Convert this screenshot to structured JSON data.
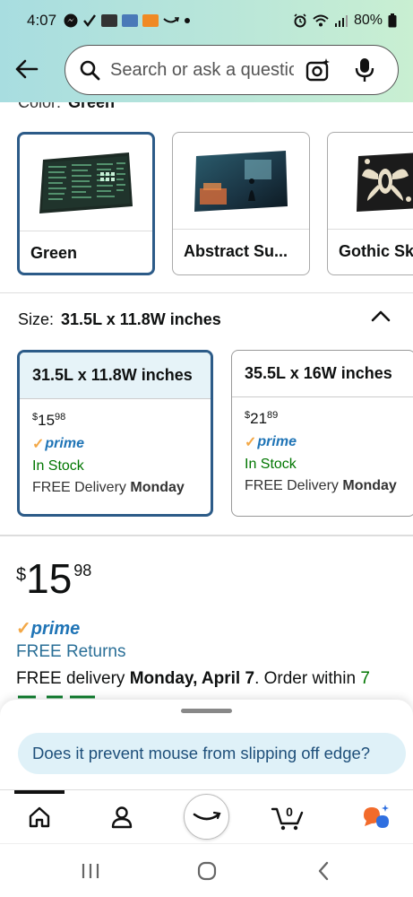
{
  "status_bar": {
    "time": "4:07",
    "battery": "80%",
    "icons": [
      "messenger-icon",
      "check-icon",
      "app-icon",
      "ebay-icon",
      "news-icon",
      "amazon-smile-icon",
      "dot-icon",
      "alarm-icon",
      "wifi-icon",
      "signal-icon",
      "battery-icon"
    ]
  },
  "search": {
    "placeholder": "Search or ask a question"
  },
  "color": {
    "label": "Color:",
    "selected": "Green",
    "options": [
      {
        "label": "Green",
        "selected": true
      },
      {
        "label": "Abstract Su...",
        "selected": false
      },
      {
        "label": "Gothic Sk",
        "selected": false
      }
    ]
  },
  "size": {
    "label": "Size:",
    "selected": "31.5L x 11.8W inches",
    "options": [
      {
        "label": "31.5L x 11.8W inches",
        "price_whole": "15",
        "price_frac": "98",
        "prime": "prime",
        "stock": "In Stock",
        "delivery_prefix": "FREE Delivery",
        "delivery_day": "Monday",
        "selected": true
      },
      {
        "label": "35.5L x 16W inches",
        "price_whole": "21",
        "price_frac": "89",
        "prime": "prime",
        "stock": "In Stock",
        "delivery_prefix": "FREE Delivery",
        "delivery_day": "Monday",
        "selected": false
      }
    ]
  },
  "buybox": {
    "currency": "$",
    "price_whole": "15",
    "price_frac": "98",
    "prime": "prime",
    "free_returns": "FREE Returns",
    "delivery_prefix": "FREE delivery ",
    "delivery_date": "Monday, April 7",
    "delivery_suffix": ". Order within ",
    "order_within": "7"
  },
  "currency_symbol": "$",
  "suggestion": {
    "question": "Does it prevent mouse from slipping off edge?"
  },
  "bottom_nav": {
    "items": [
      "home-icon",
      "account-icon",
      "amazon-icon",
      "cart-icon",
      "rufus-icon"
    ],
    "cart_count": "0"
  },
  "colors": {
    "accent_blue": "#2c5b88",
    "prime_blue": "#1f74b6",
    "stock_green": "#007600",
    "header_gradient_start": "#a8dde0",
    "header_gradient_end": "#c9efd2"
  }
}
